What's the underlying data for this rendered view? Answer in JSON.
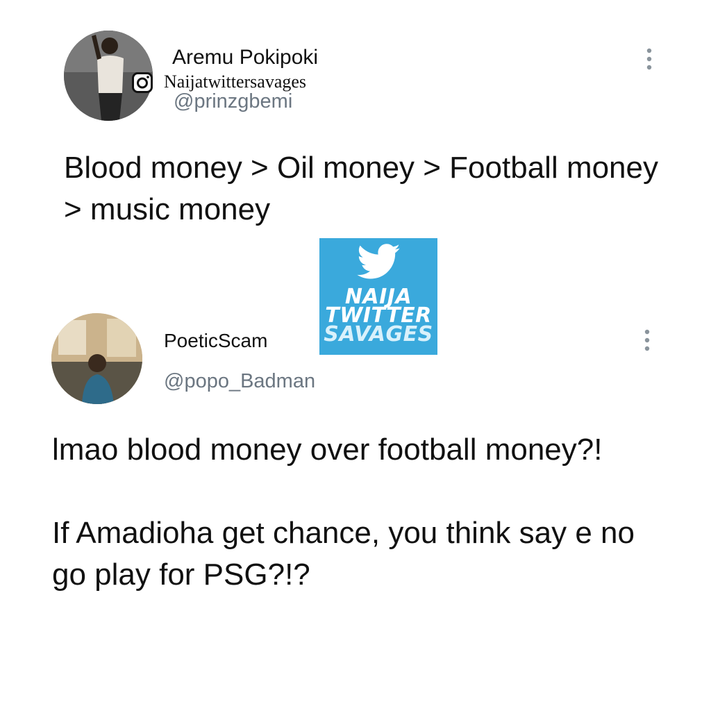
{
  "tweets": [
    {
      "name": "Aremu Pokipoki",
      "handle": "@prinzgbemi",
      "text": "Blood money > Oil money > Football money > music money"
    },
    {
      "name": "PoeticScam",
      "handle": "@popo_Badman",
      "paragraphs": [
        "lmao blood money over football money?!",
        "If Amadioha get chance, you think say e no go play for PSG?!?"
      ]
    }
  ],
  "watermark": {
    "instagram_handle": "Naijatwittersavages",
    "logo_lines": [
      "NAIJA",
      "TWITTER",
      "SAVAGES"
    ],
    "logo_color": "#3aa9dc"
  },
  "icons": {
    "more": "vertical-ellipsis-icon",
    "instagram": "instagram-icon",
    "bird": "twitter-bird-icon"
  },
  "colors": {
    "handle": "#6b7681",
    "text": "#111111"
  }
}
